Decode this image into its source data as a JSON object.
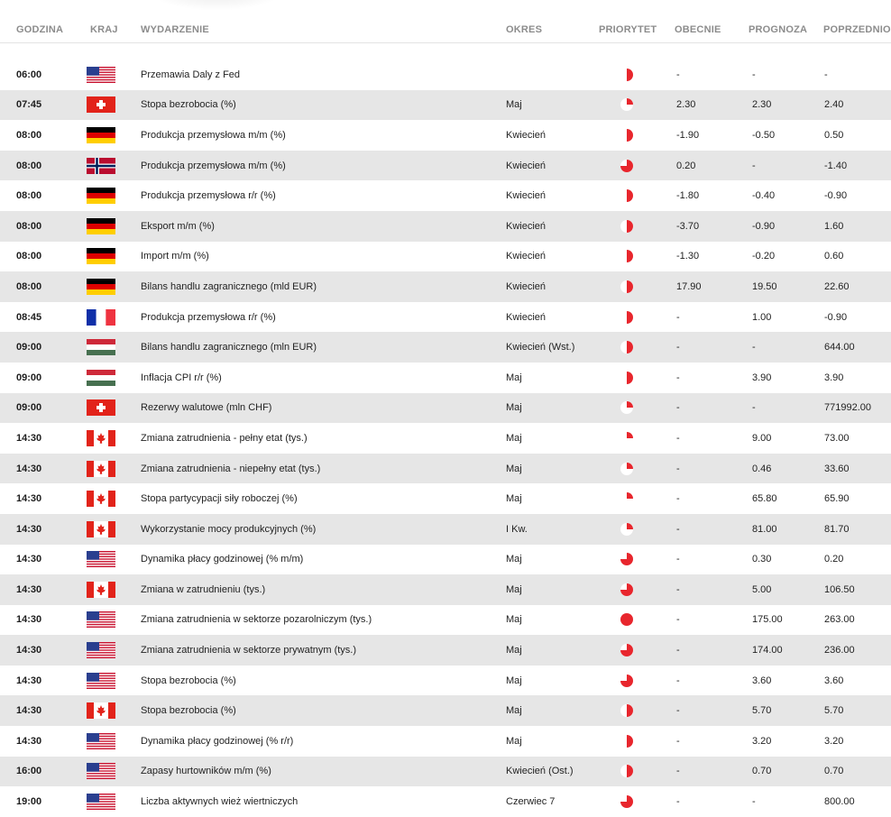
{
  "columns": {
    "time": "GODZINA",
    "country": "KRAJ",
    "event": "WYDARZENIE",
    "period": "OKRES",
    "priority": "PRIORYTET",
    "current": "OBECNIE",
    "forecast": "PROGNOZA",
    "previous": "POPRZEDNIO"
  },
  "colors": {
    "priority_red": "#e8262d",
    "row_alt": "#e6e6e6",
    "header_text": "#8c8c8c"
  },
  "rows": [
    {
      "time": "06:00",
      "country_flag": "us",
      "event": "Przemawia Daly z Fed",
      "period": "",
      "priority_fraction": 0.5,
      "current": "-",
      "forecast": "-",
      "previous": "-"
    },
    {
      "time": "07:45",
      "country_flag": "ch",
      "event": "Stopa bezrobocia (%)",
      "period": "Maj",
      "priority_fraction": 0.25,
      "current": "2.30",
      "forecast": "2.30",
      "previous": "2.40"
    },
    {
      "time": "08:00",
      "country_flag": "de",
      "event": "Produkcja przemysłowa m/m (%)",
      "period": "Kwiecień",
      "priority_fraction": 0.5,
      "current": "-1.90",
      "forecast": "-0.50",
      "previous": "0.50"
    },
    {
      "time": "08:00",
      "country_flag": "no",
      "event": "Produkcja przemysłowa m/m (%)",
      "period": "Kwiecień",
      "priority_fraction": 0.75,
      "current": "0.20",
      "forecast": "-",
      "previous": "-1.40"
    },
    {
      "time": "08:00",
      "country_flag": "de",
      "event": "Produkcja przemysłowa r/r (%)",
      "period": "Kwiecień",
      "priority_fraction": 0.5,
      "current": "-1.80",
      "forecast": "-0.40",
      "previous": "-0.90"
    },
    {
      "time": "08:00",
      "country_flag": "de",
      "event": "Eksport m/m (%)",
      "period": "Kwiecień",
      "priority_fraction": 0.5,
      "current": "-3.70",
      "forecast": "-0.90",
      "previous": "1.60"
    },
    {
      "time": "08:00",
      "country_flag": "de",
      "event": "Import m/m (%)",
      "period": "Kwiecień",
      "priority_fraction": 0.5,
      "current": "-1.30",
      "forecast": "-0.20",
      "previous": "0.60"
    },
    {
      "time": "08:00",
      "country_flag": "de",
      "event": "Bilans handlu zagranicznego (mld EUR)",
      "period": "Kwiecień",
      "priority_fraction": 0.5,
      "current": "17.90",
      "forecast": "19.50",
      "previous": "22.60"
    },
    {
      "time": "08:45",
      "country_flag": "fr",
      "event": "Produkcja przemysłowa r/r (%)",
      "period": "Kwiecień",
      "priority_fraction": 0.5,
      "current": "-",
      "forecast": "1.00",
      "previous": "-0.90"
    },
    {
      "time": "09:00",
      "country_flag": "hu",
      "event": "Bilans handlu zagranicznego (mln EUR)",
      "period": "Kwiecień (Wst.)",
      "priority_fraction": 0.5,
      "current": "-",
      "forecast": "-",
      "previous": "644.00"
    },
    {
      "time": "09:00",
      "country_flag": "hu",
      "event": "Inflacja CPI r/r (%)",
      "period": "Maj",
      "priority_fraction": 0.5,
      "current": "-",
      "forecast": "3.90",
      "previous": "3.90"
    },
    {
      "time": "09:00",
      "country_flag": "ch",
      "event": "Rezerwy walutowe (mln CHF)",
      "period": "Maj",
      "priority_fraction": 0.25,
      "current": "-",
      "forecast": "-",
      "previous": "771992.00"
    },
    {
      "time": "14:30",
      "country_flag": "ca",
      "event": "Zmiana zatrudnienia - pełny etat (tys.)",
      "period": "Maj",
      "priority_fraction": 0.25,
      "current": "-",
      "forecast": "9.00",
      "previous": "73.00"
    },
    {
      "time": "14:30",
      "country_flag": "ca",
      "event": "Zmiana zatrudnienia - niepełny etat (tys.)",
      "period": "Maj",
      "priority_fraction": 0.25,
      "current": "-",
      "forecast": "0.46",
      "previous": "33.60"
    },
    {
      "time": "14:30",
      "country_flag": "ca",
      "event": "Stopa partycypacji siły roboczej (%)",
      "period": "Maj",
      "priority_fraction": 0.25,
      "current": "-",
      "forecast": "65.80",
      "previous": "65.90"
    },
    {
      "time": "14:30",
      "country_flag": "ca",
      "event": "Wykorzystanie mocy produkcyjnych (%)",
      "period": "I Kw.",
      "priority_fraction": 0.25,
      "current": "-",
      "forecast": "81.00",
      "previous": "81.70"
    },
    {
      "time": "14:30",
      "country_flag": "us",
      "event": "Dynamika płacy godzinowej (% m/m)",
      "period": "Maj",
      "priority_fraction": 0.75,
      "current": "-",
      "forecast": "0.30",
      "previous": "0.20"
    },
    {
      "time": "14:30",
      "country_flag": "ca",
      "event": "Zmiana w zatrudnieniu (tys.)",
      "period": "Maj",
      "priority_fraction": 0.75,
      "current": "-",
      "forecast": "5.00",
      "previous": "106.50"
    },
    {
      "time": "14:30",
      "country_flag": "us",
      "event": "Zmiana zatrudnienia w sektorze pozarolniczym (tys.)",
      "period": "Maj",
      "priority_fraction": 1.0,
      "current": "-",
      "forecast": "175.00",
      "previous": "263.00"
    },
    {
      "time": "14:30",
      "country_flag": "us",
      "event": "Zmiana zatrudnienia w sektorze prywatnym (tys.)",
      "period": "Maj",
      "priority_fraction": 0.75,
      "current": "-",
      "forecast": "174.00",
      "previous": "236.00"
    },
    {
      "time": "14:30",
      "country_flag": "us",
      "event": "Stopa bezrobocia (%)",
      "period": "Maj",
      "priority_fraction": 0.75,
      "current": "-",
      "forecast": "3.60",
      "previous": "3.60"
    },
    {
      "time": "14:30",
      "country_flag": "ca",
      "event": "Stopa bezrobocia (%)",
      "period": "Maj",
      "priority_fraction": 0.5,
      "current": "-",
      "forecast": "5.70",
      "previous": "5.70"
    },
    {
      "time": "14:30",
      "country_flag": "us",
      "event": "Dynamika płacy godzinowej (% r/r)",
      "period": "Maj",
      "priority_fraction": 0.5,
      "current": "-",
      "forecast": "3.20",
      "previous": "3.20"
    },
    {
      "time": "16:00",
      "country_flag": "us",
      "event": "Zapasy hurtowników m/m (%)",
      "period": "Kwiecień (Ost.)",
      "priority_fraction": 0.5,
      "current": "-",
      "forecast": "0.70",
      "previous": "0.70"
    },
    {
      "time": "19:00",
      "country_flag": "us",
      "event": "Liczba aktywnych wież wiertniczych",
      "period": "Czerwiec 7",
      "priority_fraction": 0.75,
      "current": "-",
      "forecast": "-",
      "previous": "800.00"
    }
  ]
}
